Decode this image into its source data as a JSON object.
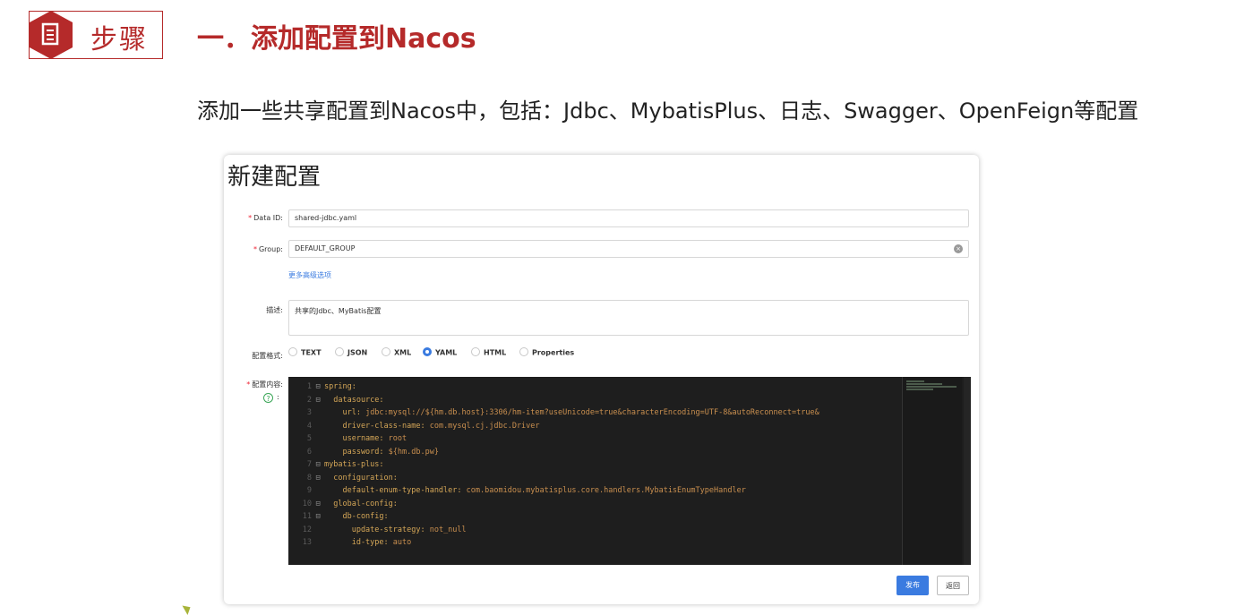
{
  "slide": {
    "badge_label": "步骤",
    "title": "一．添加配置到Nacos",
    "description": "添加一些共享配置到Nacos中，包括：Jdbc、MybatisPlus、日志、Swagger、OpenFeign等配置"
  },
  "form": {
    "title": "新建配置",
    "data_id_label": "Data ID:",
    "data_id_value": "shared-jdbc.yaml",
    "group_label": "Group:",
    "group_value": "DEFAULT_GROUP",
    "advanced_link": "更多高级选项",
    "description_label": "描述:",
    "description_value": "共享的Jdbc、MyBatis配置",
    "format_label": "配置格式:",
    "formats": [
      "TEXT",
      "JSON",
      "XML",
      "YAML",
      "HTML",
      "Properties"
    ],
    "selected_format": "YAML",
    "content_label": "配置内容:",
    "help_colon": ":",
    "publish_label": "发布",
    "back_label": "返回"
  },
  "editor": {
    "lines": [
      {
        "n": "1",
        "fold": "⊟",
        "indent": "",
        "key": "spring:",
        "val": ""
      },
      {
        "n": "2",
        "fold": "⊟",
        "indent": "  ",
        "key": "datasource:",
        "val": ""
      },
      {
        "n": "3",
        "fold": "",
        "indent": "    ",
        "key": "url:",
        "val": " jdbc:mysql://${hm.db.host}:3306/hm-item?useUnicode=true&characterEncoding=UTF-8&autoReconnect=true&"
      },
      {
        "n": "4",
        "fold": "",
        "indent": "    ",
        "key": "driver-class-name:",
        "val": " com.mysql.cj.jdbc.Driver"
      },
      {
        "n": "5",
        "fold": "",
        "indent": "    ",
        "key": "username:",
        "val": " root"
      },
      {
        "n": "6",
        "fold": "",
        "indent": "    ",
        "key": "password:",
        "val": " ${hm.db.pw}"
      },
      {
        "n": "7",
        "fold": "⊟",
        "indent": "",
        "key": "mybatis-plus:",
        "val": ""
      },
      {
        "n": "8",
        "fold": "⊟",
        "indent": "  ",
        "key": "configuration:",
        "val": ""
      },
      {
        "n": "9",
        "fold": "",
        "indent": "    ",
        "key": "default-enum-type-handler:",
        "val": " com.baomidou.mybatisplus.core.handlers.MybatisEnumTypeHandler"
      },
      {
        "n": "10",
        "fold": "⊟",
        "indent": "  ",
        "key": "global-config:",
        "val": ""
      },
      {
        "n": "11",
        "fold": "⊟",
        "indent": "    ",
        "key": "db-config:",
        "val": ""
      },
      {
        "n": "12",
        "fold": "",
        "indent": "      ",
        "key": "update-strategy:",
        "val": " not_null"
      },
      {
        "n": "13",
        "fold": "",
        "indent": "      ",
        "key": "id-type:",
        "val": " auto"
      }
    ]
  },
  "colors": {
    "accent_red": "#b52a2a",
    "primary_blue": "#3a7be0",
    "editor_bg": "#1e1e1e"
  }
}
